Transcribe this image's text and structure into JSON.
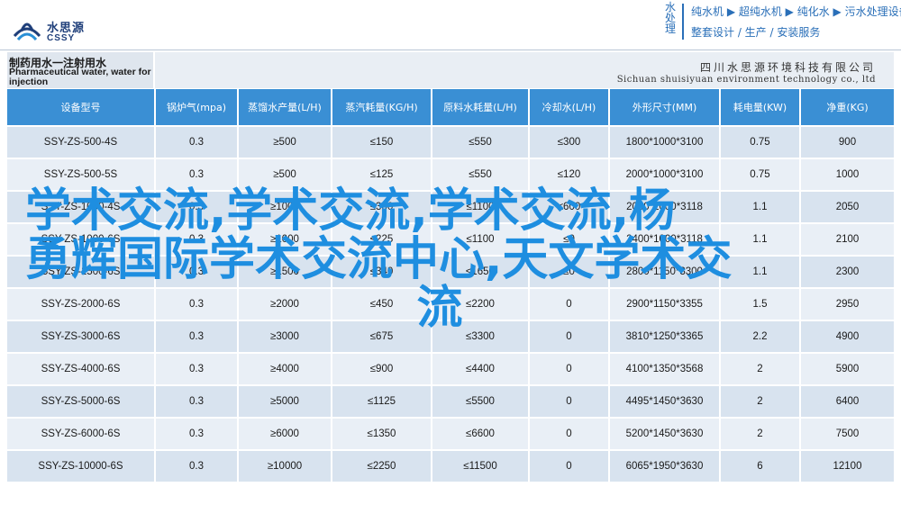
{
  "brand": {
    "logo_cn": "水思源",
    "logo_en": "CSSY",
    "color": "#1f3f7a"
  },
  "slogan": {
    "label": "水处理",
    "line1": "纯水机 ▶ 超纯水机 ▶ 纯化水 ▶ 污水处理设备",
    "line2": "整套设计 / 生产 / 安装服务",
    "color": "#2a6fb8"
  },
  "doc": {
    "title_cn": "制药用水一注射用水",
    "title_en": "Pharmaceutical water, water for injection",
    "company_cn": "四川水思源环境科技有限公司",
    "company_en": "Sichuan shuisiyuan environment technology co., ltd"
  },
  "table": {
    "header_color": "#3a8fd4",
    "headers": [
      "设备型号",
      "锅炉气(mpa)",
      "蒸馏水产量(L/H)",
      "蒸汽耗量(KG/H)",
      "原料水耗量(L/H)",
      "冷却水(L/H)",
      "外形尺寸(MM)",
      "耗电量(KW)",
      "净重(KG)"
    ],
    "rows": [
      [
        "SSY-ZS-500-4S",
        "0.3",
        "≥500",
        "≤150",
        "≤550",
        "≤300",
        "1800*1000*3100",
        "0.75",
        "900"
      ],
      [
        "SSY-ZS-500-5S",
        "0.3",
        "≥500",
        "≤125",
        "≤550",
        "≤120",
        "2000*1000*3100",
        "0.75",
        "1000"
      ],
      [
        "SSY-ZS-1000-4S",
        "0.3",
        "≥1000",
        "≤300",
        "≤1100",
        "≤600",
        "2000*1000*3118",
        "1.1",
        "2050"
      ],
      [
        "SSY-ZS-1000-6S",
        "0.3",
        "≥1000",
        "≤225",
        "≤1100",
        "≤0",
        "2400*1000*3118",
        "1.1",
        "2100"
      ],
      [
        "SSY-ZS-1500-6S",
        "0.3",
        "≥1500",
        "≤340",
        "≤1650",
        "≤0",
        "2800*1150*3300",
        "1.1",
        "2300"
      ],
      [
        "SSY-ZS-2000-6S",
        "0.3",
        "≥2000",
        "≤450",
        "≤2200",
        "0",
        "2900*1150*3355",
        "1.5",
        "2950"
      ],
      [
        "SSY-ZS-3000-6S",
        "0.3",
        "≥3000",
        "≤675",
        "≤3300",
        "0",
        "3810*1250*3365",
        "2.2",
        "4900"
      ],
      [
        "SSY-ZS-4000-6S",
        "0.3",
        "≥4000",
        "≤900",
        "≤4400",
        "0",
        "4100*1350*3568",
        "2",
        "5900"
      ],
      [
        "SSY-ZS-5000-6S",
        "0.3",
        "≥5000",
        "≤1125",
        "≤5500",
        "0",
        "4495*1450*3630",
        "2",
        "6400"
      ],
      [
        "SSY-ZS-6000-6S",
        "0.3",
        "≥6000",
        "≤1350",
        "≤6600",
        "0",
        "5200*1450*3630",
        "2",
        "7500"
      ],
      [
        "SSY-ZS-10000-6S",
        "0.3",
        "≥10000",
        "≤2250",
        "≤11500",
        "0",
        "6065*1950*3630",
        "6",
        "12100"
      ]
    ]
  },
  "overlay": {
    "line1": "学术交流,学术交流,学术交流,杨",
    "line2": "勇辉国际学术交流中心,天文学术交",
    "line3": "流",
    "color": "#1e8ee0"
  }
}
